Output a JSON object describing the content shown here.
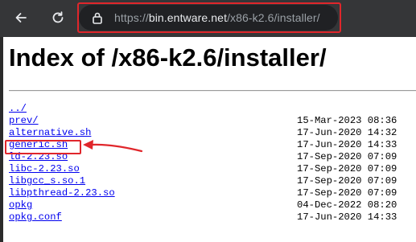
{
  "browser": {
    "url_scheme": "https://",
    "url_host": "bin.entware.net",
    "url_path": "/x86-k2.6/installer/",
    "back_icon": "arrow-left-icon",
    "reload_icon": "reload-icon",
    "lock_icon": "lock-icon"
  },
  "page": {
    "title": "Index of /x86-k2.6/installer/"
  },
  "listing": [
    {
      "name": "../",
      "date": ""
    },
    {
      "name": "prev/",
      "date": "15-Mar-2023 08:36"
    },
    {
      "name": "alternative.sh",
      "date": "17-Jun-2020 14:32"
    },
    {
      "name": "generic.sh",
      "date": "17-Jun-2020 14:33"
    },
    {
      "name": "ld-2.23.so",
      "date": "17-Sep-2020 07:09"
    },
    {
      "name": "libc-2.23.so",
      "date": "17-Sep-2020 07:09"
    },
    {
      "name": "libgcc_s.so.1",
      "date": "17-Sep-2020 07:09"
    },
    {
      "name": "libpthread-2.23.so",
      "date": "17-Sep-2020 07:09"
    },
    {
      "name": "opkg",
      "date": "04-Dec-2022 08:20"
    },
    {
      "name": "opkg.conf",
      "date": "17-Jun-2020 14:33"
    }
  ],
  "annotations": {
    "highlight_color": "#e0262b",
    "highlighted_item": "generic.sh"
  },
  "colors": {
    "link": "#0000ee",
    "chrome_bg": "#353638",
    "omnibox_bg": "#202124"
  }
}
